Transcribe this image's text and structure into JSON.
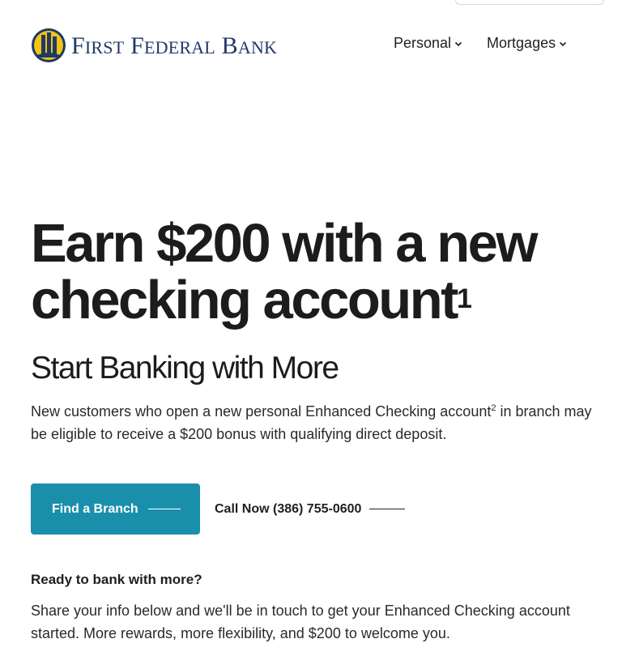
{
  "header": {
    "logo": {
      "name": "FIRST FEDERAL BANK",
      "parts": [
        {
          "cap": "F",
          "rest": "IRST"
        },
        {
          "cap": "F",
          "rest": "EDERAL"
        },
        {
          "cap": "B",
          "rest": "ANK"
        }
      ],
      "icon": "bank-building-icon"
    },
    "nav": [
      {
        "label": "Personal",
        "icon": "chevron-down-icon"
      },
      {
        "label": "Mortgages",
        "icon": "chevron-down-icon"
      }
    ]
  },
  "hero": {
    "title": "Earn $200 with a new checking account",
    "title_footnote": "1",
    "subtitle": "Start Banking with More",
    "lead_before": "New customers who open a new personal Enhanced Checking account",
    "lead_footnote": "2",
    "lead_after": " in branch may be eligible to receive a $200 bonus with qualifying direct deposit."
  },
  "cta": {
    "primary_label": "Find a Branch",
    "call_label": "Call Now (386) 755-0600"
  },
  "ready": {
    "heading": "Ready to bank with more?",
    "body": "Share your info below and we'll be in touch to get your Enhanced Checking account started. More rewards, more flexibility, and $200 to welcome you."
  },
  "colors": {
    "brand_navy": "#1e3a66",
    "logo_gold": "#f2c414",
    "button_teal": "#1a8fac",
    "text": "#1c1c1c"
  }
}
